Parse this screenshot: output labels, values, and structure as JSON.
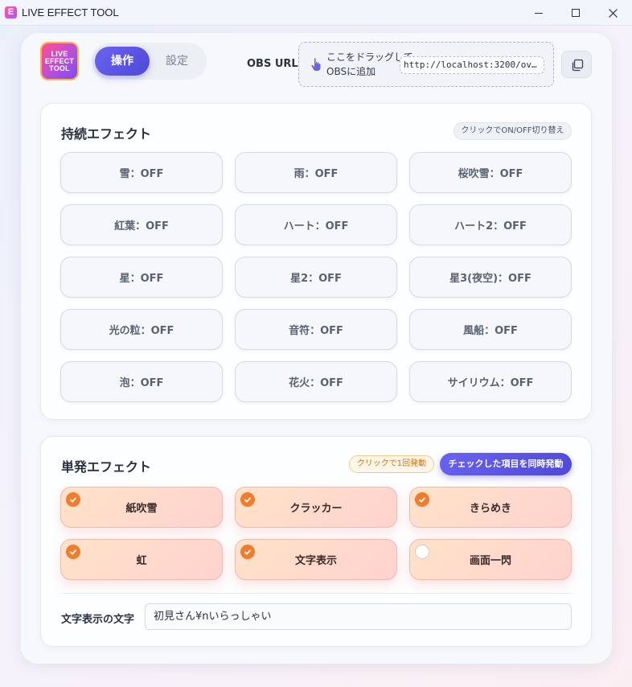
{
  "window": {
    "title": "LIVE EFFECT TOOL",
    "app_icon_letter": "E"
  },
  "logo": {
    "line1": "LIVE",
    "line2": "EFFECT",
    "line3": "TOOL"
  },
  "tabs": {
    "active": "操作",
    "inactive": "設定"
  },
  "obs": {
    "label": "OBS URL",
    "drag_line1": "ここをドラッグして",
    "drag_line2": "OBSに追加",
    "url": "http://localhost:3200/ov..."
  },
  "continuous": {
    "title": "持続エフェクト",
    "hint": "クリックでON/OFF切り替え",
    "items": [
      "雪：OFF",
      "雨：OFF",
      "桜吹雪：OFF",
      "紅葉：OFF",
      "ハート：OFF",
      "ハート2：OFF",
      "星：OFF",
      "星2：OFF",
      "星3(夜空)：OFF",
      "光の粒：OFF",
      "音符：OFF",
      "風船：OFF",
      "泡：OFF",
      "花火：OFF",
      "サイリウム：OFF"
    ]
  },
  "single": {
    "title": "単発エフェクト",
    "hint": "クリックで1回発動",
    "fire_all": "チェックした項目を同時発動",
    "items": [
      {
        "label": "紙吹雪",
        "checked": true
      },
      {
        "label": "クラッカー",
        "checked": true
      },
      {
        "label": "きらめき",
        "checked": true
      },
      {
        "label": "虹",
        "checked": true
      },
      {
        "label": "文字表示",
        "checked": true
      },
      {
        "label": "画面一閃",
        "checked": false
      }
    ],
    "text_label": "文字表示の文字",
    "text_value": "初見さん¥nいらっしゃい"
  }
}
